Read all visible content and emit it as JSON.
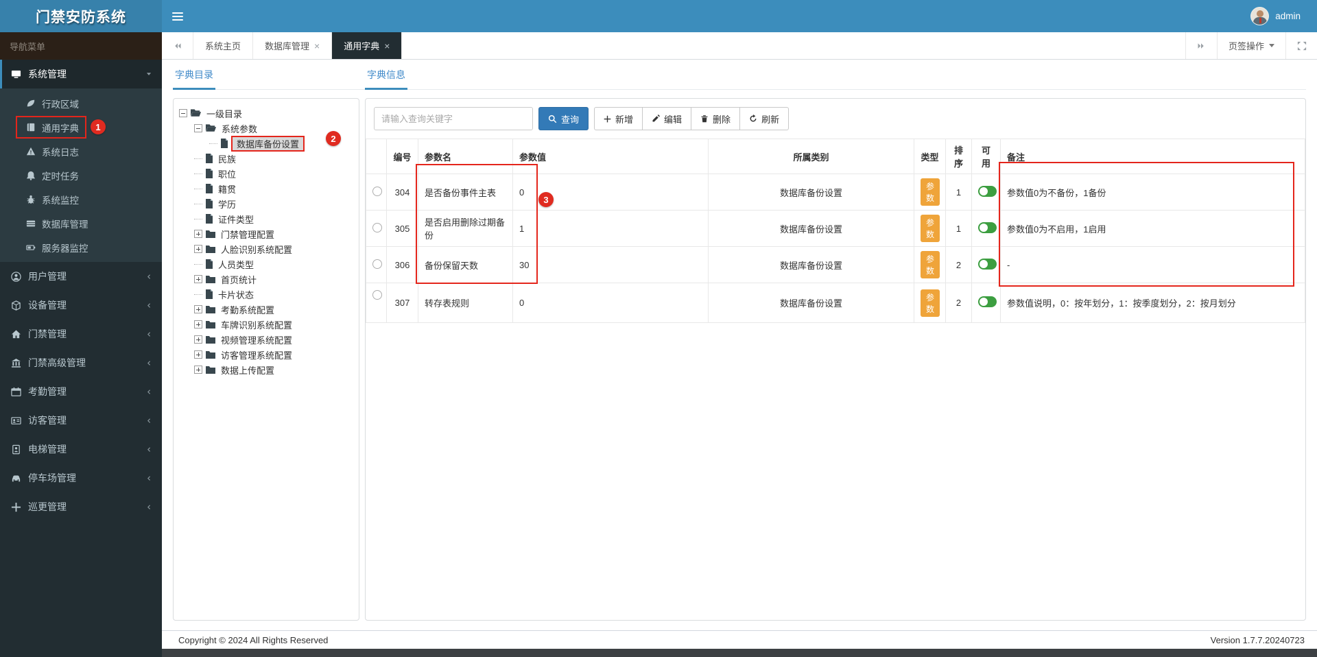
{
  "app": {
    "title": "门禁安防系统",
    "nav_label": "导航菜单",
    "user": "admin"
  },
  "tabbar": {
    "tabs": [
      {
        "label": "系统主页",
        "closable": false,
        "active": false
      },
      {
        "label": "数据库管理",
        "closable": true,
        "active": false
      },
      {
        "label": "通用字典",
        "closable": true,
        "active": true
      }
    ],
    "tab_actions_label": "页签操作"
  },
  "sidebar": {
    "active_group": {
      "label": "系统管理"
    },
    "submenu": [
      {
        "label": "行政区域"
      },
      {
        "label": "通用字典",
        "annotated": true
      },
      {
        "label": "系统日志"
      },
      {
        "label": "定时任务"
      },
      {
        "label": "系统监控"
      },
      {
        "label": "数据库管理"
      },
      {
        "label": "服务器监控"
      }
    ],
    "groups": [
      {
        "label": "用户管理"
      },
      {
        "label": "设备管理"
      },
      {
        "label": "门禁管理"
      },
      {
        "label": "门禁高级管理"
      },
      {
        "label": "考勤管理"
      },
      {
        "label": "访客管理"
      },
      {
        "label": "电梯管理"
      },
      {
        "label": "停车场管理"
      },
      {
        "label": "巡更管理"
      }
    ]
  },
  "panels": {
    "tree_tab": "字典目录",
    "info_tab": "字典信息"
  },
  "tree": {
    "nodes": [
      {
        "label": "一级目录",
        "type": "folder-open"
      },
      {
        "label": "系统参数",
        "type": "folder-open"
      },
      {
        "label": "数据库备份设置",
        "type": "leaf",
        "selected": true
      },
      {
        "label": "民族",
        "type": "leaf"
      },
      {
        "label": "职位",
        "type": "leaf"
      },
      {
        "label": "籍贯",
        "type": "leaf"
      },
      {
        "label": "学历",
        "type": "leaf"
      },
      {
        "label": "证件类型",
        "type": "leaf"
      },
      {
        "label": "门禁管理配置",
        "type": "folder-closed"
      },
      {
        "label": "人脸识别系统配置",
        "type": "folder-closed"
      },
      {
        "label": "人员类型",
        "type": "leaf"
      },
      {
        "label": "首页统计",
        "type": "folder-closed"
      },
      {
        "label": "卡片状态",
        "type": "leaf"
      },
      {
        "label": "考勤系统配置",
        "type": "folder-closed"
      },
      {
        "label": "车牌识别系统配置",
        "type": "folder-closed"
      },
      {
        "label": "视频管理系统配置",
        "type": "folder-closed"
      },
      {
        "label": "访客管理系统配置",
        "type": "folder-closed"
      },
      {
        "label": "数据上传配置",
        "type": "folder-closed"
      }
    ]
  },
  "toolbar": {
    "search_placeholder": "请输入查询关键字",
    "search_button": "查询",
    "add_button": "新增",
    "edit_button": "编辑",
    "delete_button": "删除",
    "refresh_button": "刷新"
  },
  "table": {
    "headers": {
      "id": "编号",
      "name": "参数名",
      "value": "参数值",
      "category": "所属类别",
      "type": "类型",
      "sort": "排序",
      "enabled": "可用",
      "remark": "备注"
    },
    "rows": [
      {
        "id": "304",
        "name": "是否备份事件主表",
        "value": "0",
        "category": "数据库备份设置",
        "type": "参数",
        "sort": "1",
        "enabled": "on",
        "remark": "参数值0为不备份，1备份"
      },
      {
        "id": "305",
        "name": "是否启用删除过期备份",
        "value": "1",
        "category": "数据库备份设置",
        "type": "参数",
        "sort": "1",
        "enabled": "on",
        "remark": "参数值0为不启用，1启用"
      },
      {
        "id": "306",
        "name": "备份保留天数",
        "value": "30",
        "category": "数据库备份设置",
        "type": "参数",
        "sort": "2",
        "enabled": "on",
        "remark": "-"
      },
      {
        "id": "307",
        "name": "转存表规则",
        "value": "0",
        "category": "数据库备份设置",
        "type": "参数",
        "sort": "2",
        "enabled": "on",
        "remark": "参数值说明，0：按年划分，1：按季度划分，2：按月划分"
      }
    ]
  },
  "annotations": {
    "marker1": "1",
    "marker2": "2",
    "marker3": "3"
  },
  "footer": {
    "copyright": "Copyright © 2024 All Rights Reserved",
    "version": "Version 1.7.7.20240723"
  },
  "colors": {
    "navbar_blue": "#3c8dbc",
    "logo_blue": "#3781ab",
    "sidebar_dark": "#222d32",
    "submenu_dark": "#2c3b41",
    "accent_blue": "#428bca",
    "badge_orange": "#efa43a",
    "toggle_green": "#3c9e40",
    "annotation_red": "#e4251b"
  }
}
